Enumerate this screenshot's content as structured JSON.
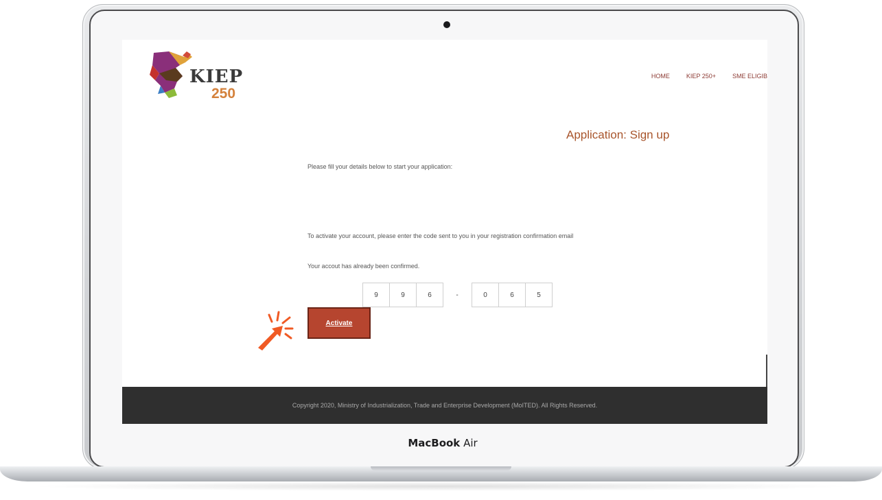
{
  "device": {
    "label_bold": "MacBook",
    "label_rest": " Air"
  },
  "site": {
    "logo_text": "KIEP",
    "logo_number": "250"
  },
  "nav": {
    "items": [
      "HOME",
      "KIEP 250+",
      "SME ELIGIB"
    ]
  },
  "page": {
    "title": "Application: Sign up",
    "intro": "Please fill your details below to start your application:",
    "activate_instructions": "To activate your account, please enter the code sent to you in your registration confirmation email",
    "status_message": "Your accout has already been confirmed.",
    "code_digits": [
      "9",
      "9",
      "6",
      "0",
      "6",
      "5"
    ],
    "code_separator": "-",
    "activate_button": "Activate"
  },
  "footer": {
    "copyright": "Copyright 2020, Ministry of Industrialization, Trade and Enterprise Development (MoITED). All Rights Reserved."
  },
  "colors": {
    "accent": "#b6452f",
    "title": "#a8552c",
    "nav": "#8c3a33",
    "footer_bg": "#2f2f2f",
    "cursor": "#f05a24"
  }
}
